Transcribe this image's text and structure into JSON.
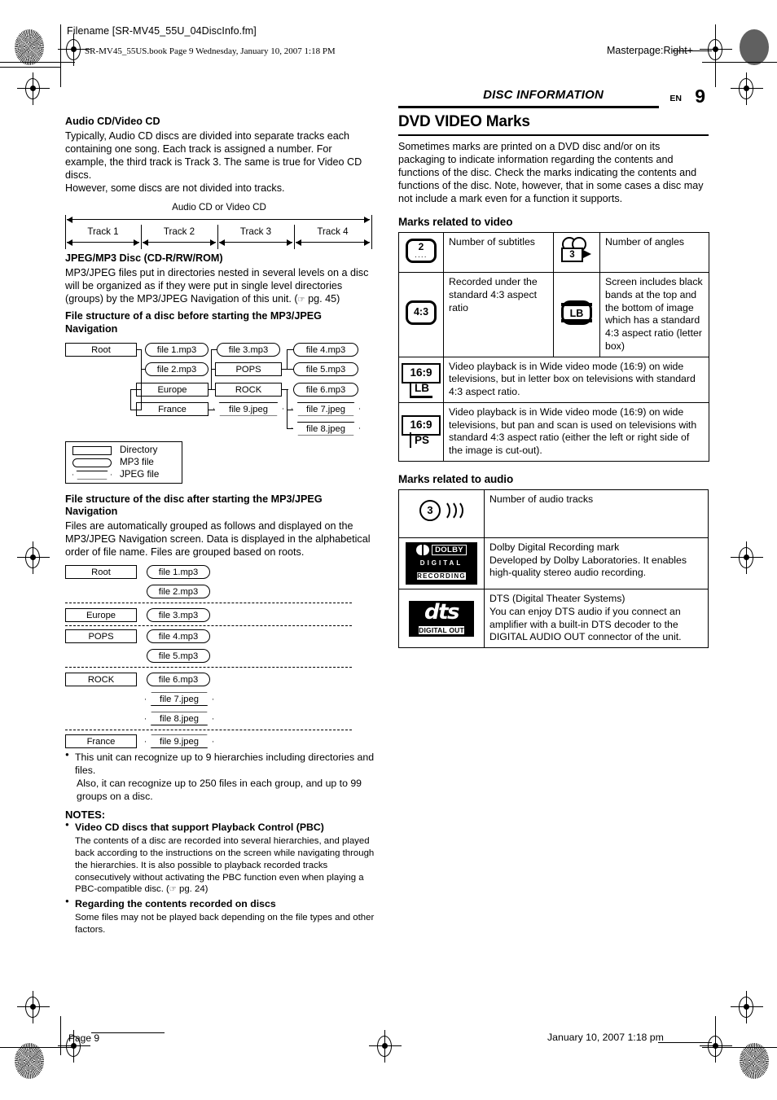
{
  "slug": {
    "filename": "Filename [SR-MV45_55U_04DiscInfo.fm]",
    "book_line": "SR-MV45_55US.book  Page 9  Wednesday, January 10, 2007  1:18 PM",
    "masterpage": "Masterpage:Right+"
  },
  "running_head": {
    "section": "DISC INFORMATION",
    "lang": "EN",
    "page_number": "9"
  },
  "left": {
    "audio_cd": {
      "heading": "Audio CD/Video CD",
      "para1": "Typically, Audio CD discs are divided into separate tracks each containing one song. Each track is assigned a number. For example, the third track is Track 3. The same is true for Video CD discs.",
      "para2": "However, some discs are not divided into tracks.",
      "diagram": {
        "span_label": "Audio CD or Video CD",
        "tracks": [
          "Track 1",
          "Track 2",
          "Track 3",
          "Track 4"
        ]
      }
    },
    "jpeg_mp3": {
      "heading": "JPEG/MP3 Disc (CD-R/RW/ROM)",
      "para": "MP3/JPEG files put in directories nested in several levels on a disc will be organized as if they were put in single level directories (groups) by the MP3/JPEG Navigation of this unit. (",
      "para_ref": "pg. 45)",
      "before_heading": "File structure of a disc before starting the MP3/JPEG Navigation",
      "after_heading": "File structure of the disc after starting the MP3/JPEG Navigation",
      "after_para": "Files are automatically grouped as follows and displayed on the MP3/JPEG Navigation screen. Data is displayed in the alphabetical order of file name. Files are grouped based on roots."
    },
    "tree_before": {
      "root": "Root",
      "file1": "file 1.mp3",
      "file2": "file 2.mp3",
      "europe": "Europe",
      "france": "France",
      "file3": "file 3.mp3",
      "pops": "POPS",
      "rock": "ROCK",
      "file9": "file 9.jpeg",
      "file4": "file 4.mp3",
      "file5": "file 5.mp3",
      "file6": "file 6.mp3",
      "file7": "file 7.jpeg",
      "file8": "file 8.jpeg"
    },
    "legend": {
      "directory": "Directory",
      "mp3": "MP3 file",
      "jpeg": "JPEG file"
    },
    "tree_after": {
      "groups": [
        {
          "name": "Root",
          "files": [
            "file 1.mp3",
            "file 2.mp3"
          ]
        },
        {
          "name": "Europe",
          "files": [
            "file 3.mp3"
          ]
        },
        {
          "name": "POPS",
          "files": [
            "file 4.mp3",
            "file 5.mp3"
          ]
        },
        {
          "name": "ROCK",
          "files": [
            "file 6.mp3",
            "file 7.jpeg",
            "file 8.jpeg"
          ]
        },
        {
          "name": "France",
          "files": [
            "file 9.jpeg"
          ]
        }
      ],
      "g0_name": "Root",
      "g0_f0": "file 1.mp3",
      "g0_f1": "file 2.mp3",
      "g1_name": "Europe",
      "g1_f0": "file 3.mp3",
      "g2_name": "POPS",
      "g2_f0": "file 4.mp3",
      "g2_f1": "file 5.mp3",
      "g3_name": "ROCK",
      "g3_f0": "file 6.mp3",
      "g3_f1": "file 7.jpeg",
      "g3_f2": "file 8.jpeg",
      "g4_name": "France",
      "g4_f0": "file 9.jpeg"
    },
    "bullet_hierarchies": "This unit can recognize up to 9 hierarchies including directories and files.",
    "bullet_hierarchies_2": "Also, it can recognize up to 250 files in each group, and up to 99 groups on a disc.",
    "notes": {
      "title": "NOTES:",
      "n1_title": "Video CD discs that support Playback Control (PBC)",
      "n1_body": "The contents of a disc are recorded into several hierarchies, and played back according to the instructions on the screen while navigating through the hierarchies. It is also possible to playback recorded tracks consecutively without activating the PBC function even when playing a PBC-compatible disc. (",
      "n1_ref": "pg. 24)",
      "n2_title": "Regarding the contents recorded on discs",
      "n2_body": "Some files may not be played back depending on the file types and other factors."
    }
  },
  "right": {
    "title": "DVD VIDEO Marks",
    "intro": "Sometimes marks are printed on a DVD disc and/or on its packaging to indicate information regarding the contents and functions of the disc. Check the marks indicating the contents and functions of the disc. Note, however, that in some cases a disc may not include a mark even for a function it supports.",
    "video_heading": "Marks related to video",
    "audio_heading": "Marks related to audio",
    "video_table": {
      "r1c1_icon_value": "2",
      "r1c1_icon_dots": "....",
      "r1c2": "Number of subtitles",
      "r1c3_icon_value": "3",
      "r1c4": "Number of angles",
      "r2c1_icon_value": "4:3",
      "r2c2": "Recorded under the standard 4:3 aspect ratio",
      "r2c3_icon_value": "LB",
      "r2c4": "Screen includes black bands at the top and the bottom of image which has a standard 4:3 aspect ratio (letter box)",
      "r3_icon_a": "16:9",
      "r3_icon_b": "LB",
      "r3_text": "Video playback is in Wide video mode (16:9) on wide televisions, but in letter box on televisions with standard 4:3 aspect ratio.",
      "r4_icon_a": "16:9",
      "r4_icon_b": "PS",
      "r4_text": "Video playback is in Wide video mode (16:9) on wide televisions, but pan and scan is used on televisions with standard 4:3 aspect ratio (either the left or right side of the image is cut-out)."
    },
    "audio_table": {
      "r1_icon_value": "3",
      "r1_text": "Number of audio tracks",
      "r2_icon": {
        "brand": "DOLBY",
        "line2": "DIGITAL",
        "line3": "RECORDING"
      },
      "r2_text": "Dolby Digital Recording mark\nDeveloped by Dolby Laboratories. It enables high-quality stereo audio recording.",
      "r3_icon": {
        "wordmark": "dts",
        "sub": "DIGITAL OUT"
      },
      "r3_text": "DTS (Digital Theater Systems)\nYou can enjoy DTS audio if you connect an amplifier with a built-in DTS decoder to the DIGITAL AUDIO OUT connector of the unit."
    }
  },
  "footer": {
    "page": "Page 9",
    "date": "January 10, 2007 1:18 pm"
  }
}
